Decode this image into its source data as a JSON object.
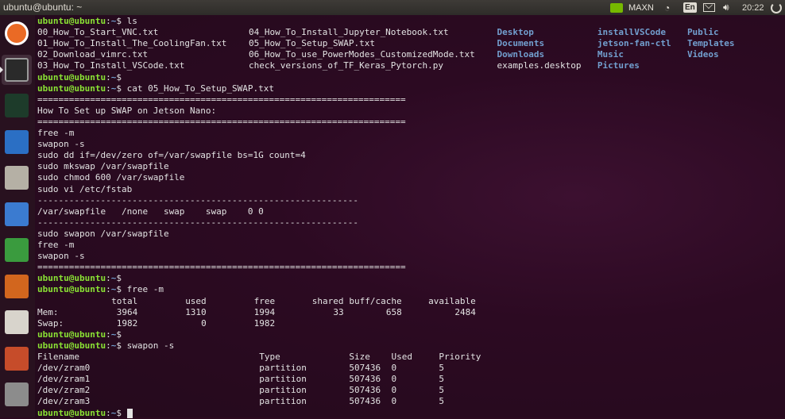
{
  "window": {
    "title": "ubuntu@ubuntu: ~"
  },
  "panel": {
    "maxn": "MAXN",
    "lang": "En",
    "clock": "20:22"
  },
  "launcher": [
    {
      "name": "dash-home",
      "color": "#ea6a25"
    },
    {
      "name": "terminal",
      "color": "#2a2a2a"
    },
    {
      "name": "system-monitor",
      "color": "#1d3b2a"
    },
    {
      "name": "text-editor",
      "color": "#2b6fc4"
    },
    {
      "name": "files",
      "color": "#b5b0a5"
    },
    {
      "name": "libreoffice-writer",
      "color": "#3b7bd0"
    },
    {
      "name": "libreoffice-calc",
      "color": "#3a9b3e"
    },
    {
      "name": "libreoffice-impress",
      "color": "#d2661e"
    },
    {
      "name": "software-center",
      "color": "#d8d4cc"
    },
    {
      "name": "system-settings",
      "color": "#c64c2a"
    },
    {
      "name": "disk",
      "color": "#8c8c8c"
    }
  ],
  "prompt": {
    "user": "ubuntu@ubuntu",
    "sep": ":",
    "path": "~",
    "sigil": "$"
  },
  "terminal": {
    "ls_cmd": "ls",
    "ls_files": [
      [
        "00_How_To_Start_VNC.txt",
        "04_How_To_Install_Jupyter_Notebook.txt"
      ],
      [
        "01_How_To_Install_The_CoolingFan.txt",
        "05_How_To_Setup_SWAP.txt"
      ],
      [
        "02_Download_vimrc.txt",
        "06_How_To_use_PowerModes_CustomizedMode.txt"
      ],
      [
        "03_How_To_Install_VSCode.txt",
        "check_versions_of_TF_Keras_Pytorch.py"
      ]
    ],
    "ls_col3": [
      "Desktop",
      "Documents",
      "Downloads",
      "examples.desktop"
    ],
    "ls_col3_isdir": [
      true,
      true,
      true,
      false
    ],
    "ls_col4": [
      "installVSCode",
      "jetson-fan-ctl",
      "Music",
      "Pictures"
    ],
    "ls_col5": [
      "Public",
      "Templates",
      "Videos",
      ""
    ],
    "cat_cmd": "cat 05_How_To_Setup_SWAP.txt",
    "rule_eq": "======================================================================",
    "heading": "How To Set up SWAP on Jetson Nano:",
    "cmds1": [
      "free -m",
      "swapon -s",
      "sudo dd if=/dev/zero of=/var/swapfile bs=1G count=4",
      "sudo mkswap /var/swapfile",
      "sudo chmod 600 /var/swapfile",
      "sudo vi /etc/fstab"
    ],
    "rule_dash": "-------------------------------------------------------------",
    "fstab": "/var/swapfile   /none   swap    swap    0 0",
    "cmds2": [
      "sudo swapon /var/swapfile",
      "free -m",
      "swapon -s"
    ],
    "free_cmd": "free -m",
    "free_header": [
      "total",
      "used",
      "free",
      "shared",
      "buff/cache",
      "available"
    ],
    "free_mem": [
      "Mem:",
      "3964",
      "1310",
      "1994",
      "33",
      "658",
      "2484"
    ],
    "free_swap": [
      "Swap:",
      "1982",
      "0",
      "1982"
    ],
    "swapon_cmd": "swapon -s",
    "swap_header": [
      "Filename",
      "Type",
      "Size",
      "Used",
      "Priority"
    ],
    "swap_rows": [
      [
        "/dev/zram0",
        "partition",
        "507436",
        "0",
        "5"
      ],
      [
        "/dev/zram1",
        "partition",
        "507436",
        "0",
        "5"
      ],
      [
        "/dev/zram2",
        "partition",
        "507436",
        "0",
        "5"
      ],
      [
        "/dev/zram3",
        "partition",
        "507436",
        "0",
        "5"
      ]
    ]
  }
}
